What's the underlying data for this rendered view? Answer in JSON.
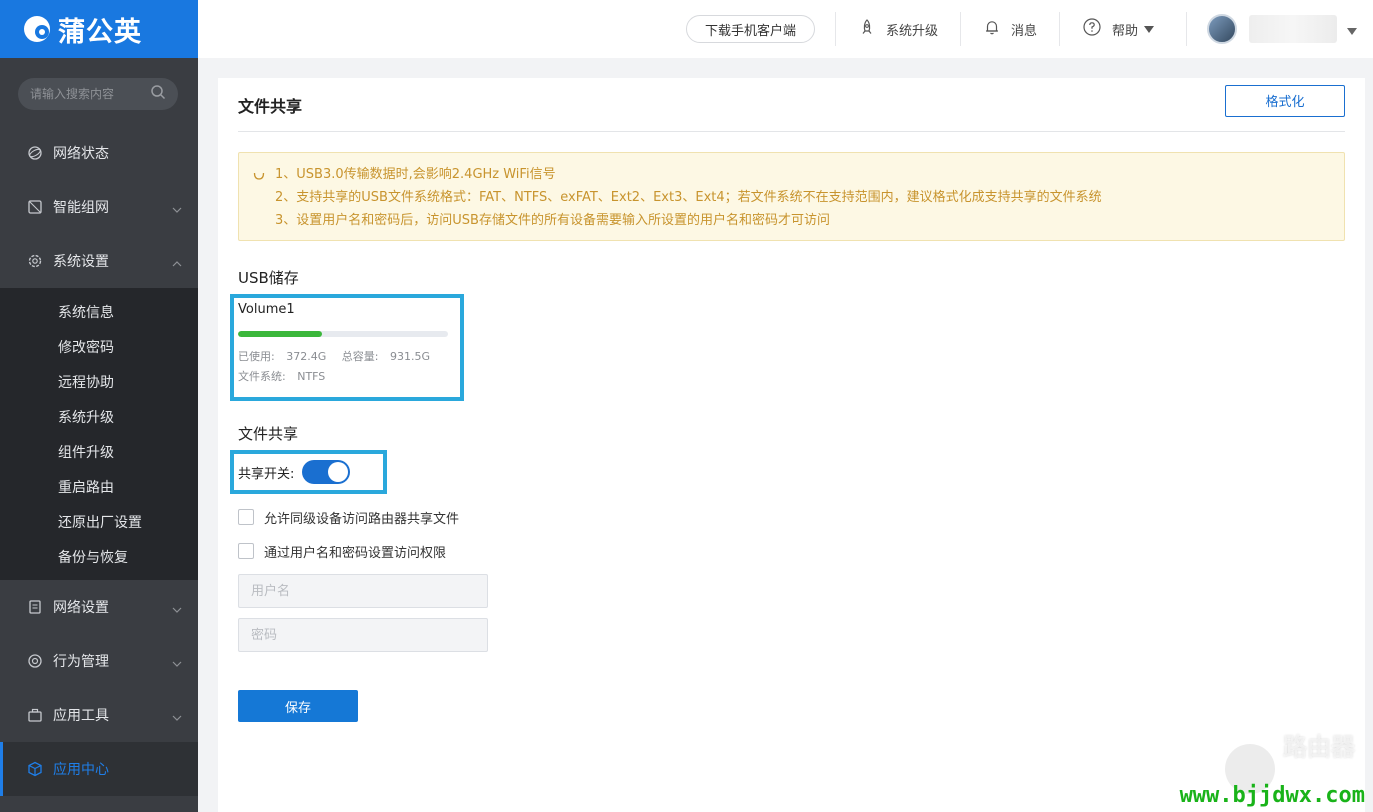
{
  "brand": {
    "name": "蒲公英",
    "color": "#1978e0"
  },
  "sidebar": {
    "search_placeholder": "请输入搜索内容",
    "items": [
      {
        "label": "网络状态",
        "icon": "globe-icon"
      },
      {
        "label": "智能组网",
        "icon": "network-icon",
        "expandable": true
      },
      {
        "label": "系统设置",
        "icon": "gear-icon",
        "expanded": true
      },
      {
        "label": "网络设置",
        "icon": "document-icon",
        "expandable": true
      },
      {
        "label": "行为管理",
        "icon": "behavior-icon",
        "expandable": true
      },
      {
        "label": "应用工具",
        "icon": "toolbox-icon",
        "expandable": true
      },
      {
        "label": "应用中心",
        "icon": "cube-icon",
        "active": true
      }
    ],
    "submenu": [
      "系统信息",
      "修改密码",
      "远程协助",
      "系统升级",
      "组件升级",
      "重启路由",
      "还原出厂设置",
      "备份与恢复"
    ]
  },
  "header": {
    "download_label": "下载手机客户端",
    "upgrade_label": "系统升级",
    "messages_label": "消息",
    "help_label": "帮助"
  },
  "page": {
    "title": "文件共享",
    "format_label": "格式化",
    "notices": [
      "1、USB3.0传输数据时,会影响2.4GHz WiFi信号",
      "2、支持共享的USB文件系统格式：FAT、NTFS、exFAT、Ext2、Ext3、Ext4；若文件系统不在支持范围内，建议格式化成支持共享的文件系统",
      "3、设置用户名和密码后，访问USB存储文件的所有设备需要输入所设置的用户名和密码才可访问"
    ],
    "usb_title": "USB储存",
    "volume": {
      "name": "Volume1",
      "used_label": "已使用:",
      "used": "372.4G",
      "total_label": "总容量:",
      "total": "931.5G",
      "fs_label": "文件系统:",
      "fs": "NTFS",
      "usage_fraction": 0.4
    },
    "share_title": "文件共享",
    "share_switch_label": "共享开关:",
    "share_enabled": true,
    "option_same_level": "允许同级设备访问路由器共享文件",
    "option_auth": "通过用户名和密码设置访问权限",
    "username_placeholder": "用户名",
    "password_placeholder": "密码",
    "save_label": "保存"
  },
  "watermark": {
    "text": "路由器",
    "url": "www.bjjdwx.com"
  }
}
